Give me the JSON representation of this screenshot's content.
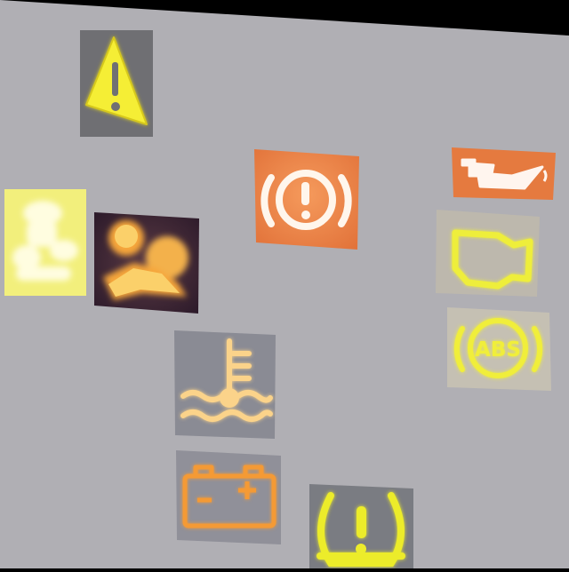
{
  "scene": {
    "background_color": "#000000",
    "board_color": "#b0afb4",
    "glow_yellow": "#f2ee3a",
    "glow_orange": "#f29a2a"
  },
  "icons": [
    {
      "name": "warning-triangle-icon",
      "color": "yellow"
    },
    {
      "name": "brake-warning-icon",
      "color": "white-on-orange"
    },
    {
      "name": "oil-pressure-icon",
      "color": "white-on-orange"
    },
    {
      "name": "check-engine-icon",
      "color": "yellow"
    },
    {
      "name": "abs-warning-icon",
      "color": "yellow",
      "label": "ABS"
    },
    {
      "name": "seat-occupancy-icon",
      "color": "yellow"
    },
    {
      "name": "airbag-warning-icon",
      "color": "orange"
    },
    {
      "name": "coolant-temperature-icon",
      "color": "orange"
    },
    {
      "name": "battery-warning-icon",
      "color": "orange"
    },
    {
      "name": "tire-pressure-icon",
      "color": "yellow"
    }
  ]
}
